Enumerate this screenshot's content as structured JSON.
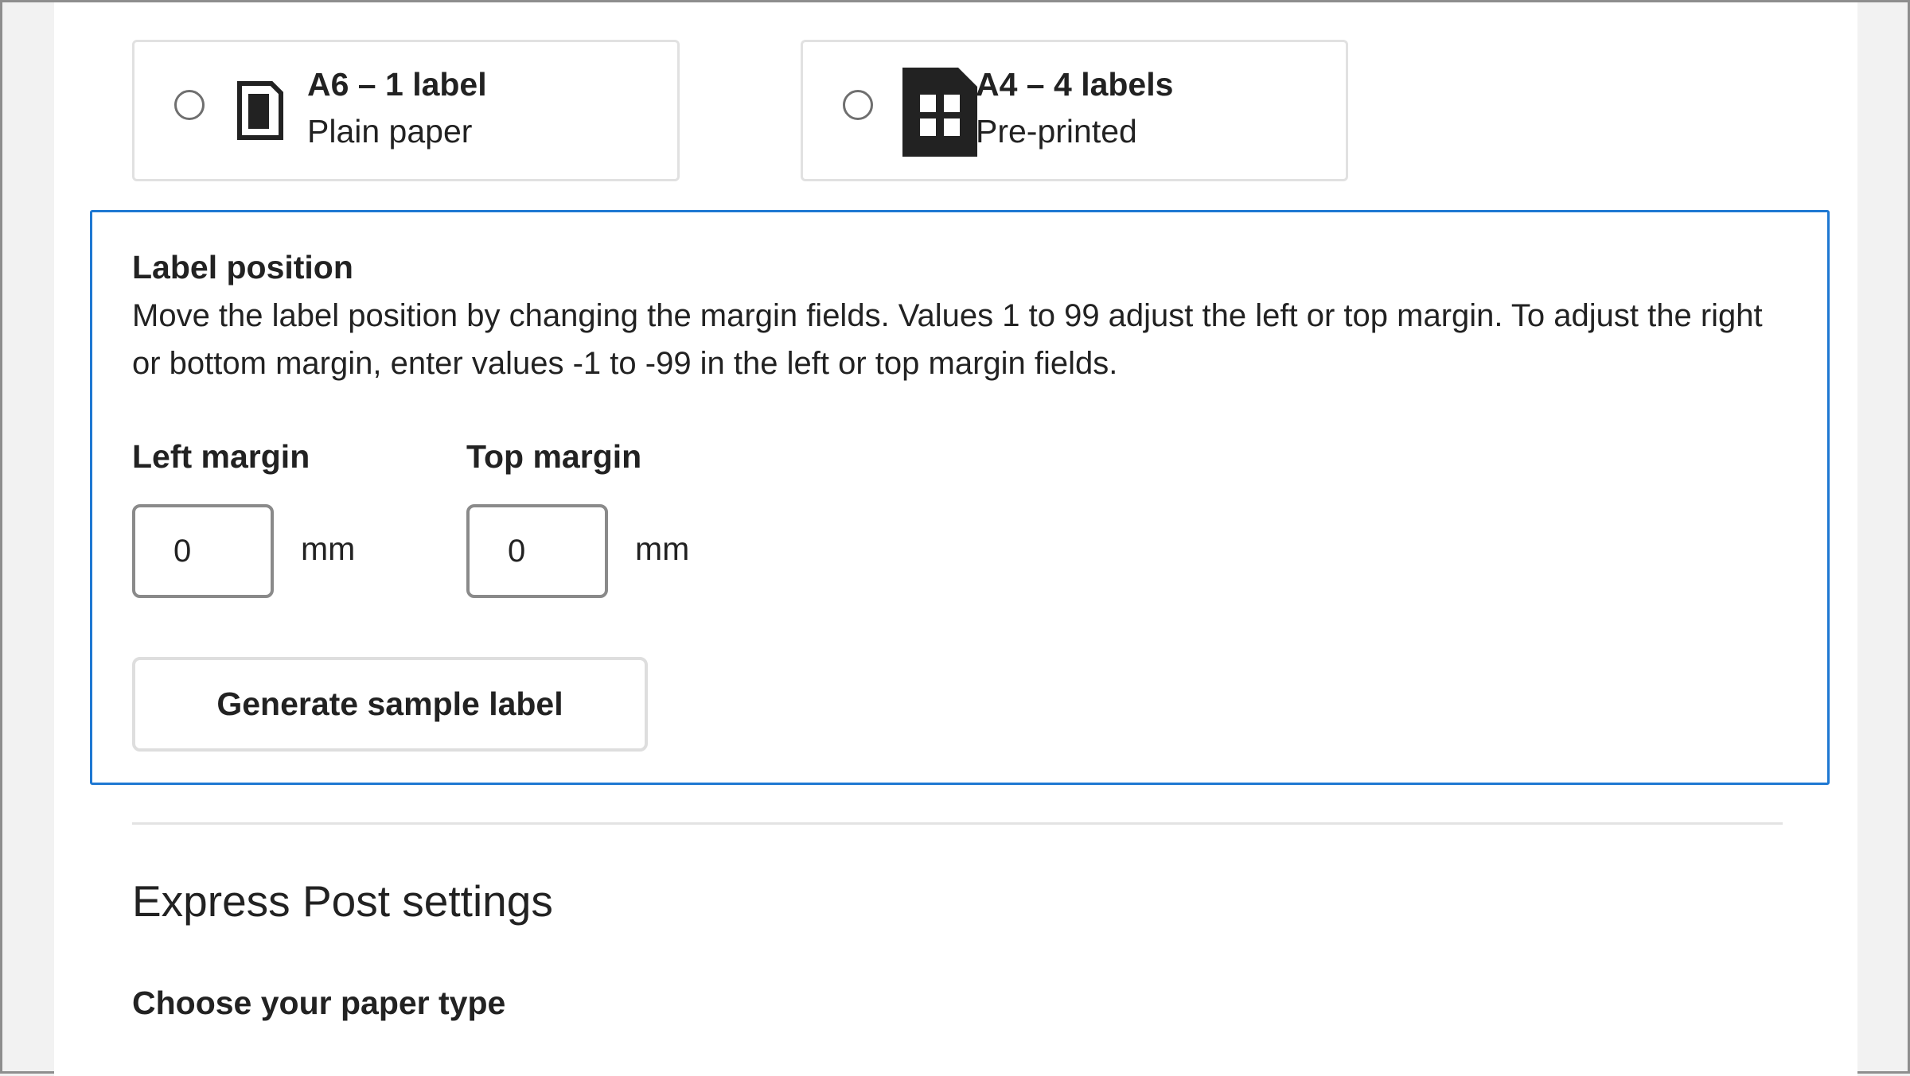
{
  "label_options": [
    {
      "title": "A6 – 1 label",
      "subtitle": "Plain paper",
      "icon": "single-label-page-icon",
      "selected": false
    },
    {
      "title": "A4 – 4 labels",
      "subtitle": "Pre-printed",
      "icon": "four-label-page-icon",
      "selected": false
    }
  ],
  "label_position": {
    "title": "Label position",
    "description": "Move the label position by changing the margin fields. Values 1 to 99 adjust the left or top margin. To adjust the right or bottom margin, enter values -1 to -99 in the left or top margin fields.",
    "left_margin": {
      "label": "Left margin",
      "value": "0",
      "unit": "mm"
    },
    "top_margin": {
      "label": "Top margin",
      "value": "0",
      "unit": "mm"
    },
    "sample_button_label": "Generate sample label"
  },
  "express_post": {
    "heading": "Express Post settings",
    "paper_type_heading": "Choose your paper type"
  },
  "colors": {
    "panel_border": "#1e78d2",
    "card_border": "#e1e1e1",
    "text": "#222222"
  }
}
